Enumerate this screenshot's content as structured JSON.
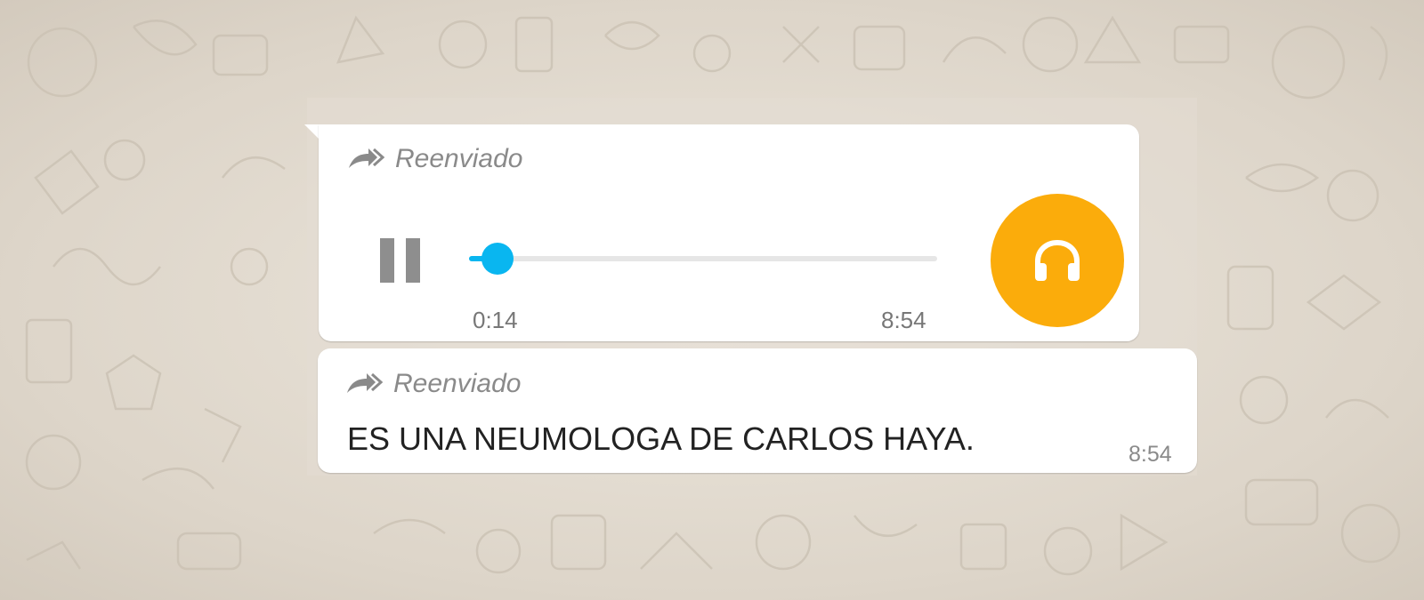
{
  "chat": {
    "background_color": "#e5ddd5",
    "doodle_watermark": "WhatsApp"
  },
  "messages": [
    {
      "type": "audio",
      "forwarded_label": "Reenviado",
      "forward_icon": "forward-arrow-icon",
      "playback_state": "playing",
      "control_icon": "pause-icon",
      "progress_fraction": 0.06,
      "current_time": "0:14",
      "duration": "8:54",
      "avatar_icon": "headphones-icon",
      "accent_color": "#09b6f0",
      "avatar_color": "#fbac0b"
    },
    {
      "type": "text",
      "forwarded_label": "Reenviado",
      "forward_icon": "forward-arrow-icon",
      "text": "ES UNA NEUMOLOGA DE CARLOS HAYA.",
      "timestamp": "8:54"
    }
  ]
}
